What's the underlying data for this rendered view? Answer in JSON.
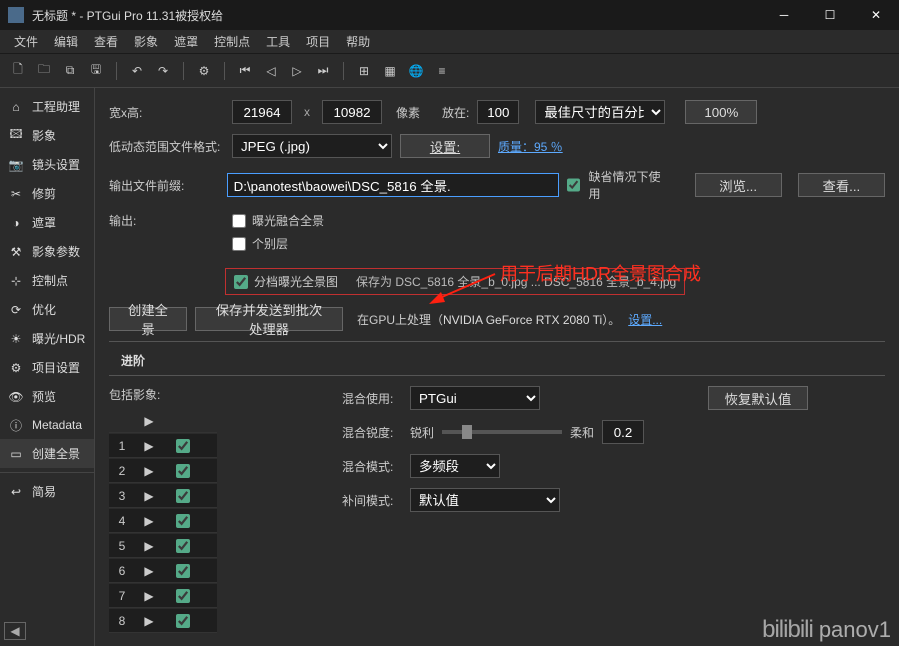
{
  "title": "无标题 * - PTGui Pro 11.31被授权给",
  "menu": [
    "文件",
    "编辑",
    "查看",
    "影象",
    "遮罩",
    "控制点",
    "工具",
    "项目",
    "帮助"
  ],
  "sidebar": [
    {
      "icon": "home",
      "label": "工程助理"
    },
    {
      "icon": "image",
      "label": "影象"
    },
    {
      "icon": "camera",
      "label": "镜头设置"
    },
    {
      "icon": "crop",
      "label": "修剪"
    },
    {
      "icon": "mask",
      "label": "遮罩"
    },
    {
      "icon": "params",
      "label": "影象参数"
    },
    {
      "icon": "ctrl",
      "label": "控制点"
    },
    {
      "icon": "opt",
      "label": "优化"
    },
    {
      "icon": "sun",
      "label": "曝光/HDR"
    },
    {
      "icon": "gear",
      "label": "项目设置"
    },
    {
      "icon": "eye",
      "label": "预览"
    },
    {
      "icon": "info",
      "label": "Metadata"
    },
    {
      "icon": "pano",
      "label": "创建全景"
    }
  ],
  "sidebar_simple": {
    "icon": "back",
    "label": "简易"
  },
  "dims": {
    "label": "宽x高:",
    "w": "21964",
    "h": "10982",
    "px": "像素",
    "store": "放在:",
    "pct": "100",
    "optsize": "最佳尺寸的百分比",
    "btn100": "100%"
  },
  "ldr": {
    "label": "低动态范围文件格式:",
    "fmt": "JPEG (.jpg)",
    "set": "设置:",
    "quality": "质量：95 ％"
  },
  "outfile": {
    "label": "输出文件前缀:",
    "path": "D:\\panotest\\baowei\\DSC_5816 全景.",
    "default_chk": true,
    "default_lbl": "缺省情况下使用",
    "browse": "浏览...",
    "view": "查看..."
  },
  "output": {
    "label": "输出:",
    "opt1": "曝光融合全景",
    "opt2": "个别层",
    "opt3": "分档曝光全景图",
    "opt3_save": "保存为 DSC_5816 全景_b_0.jpg ... DSC_5816 全景_b_4.jpg"
  },
  "annotation": "用于后期HDR全景图合成",
  "create": {
    "btn": "创建全景",
    "batch": "保存并发送到批次处理器",
    "gpu_prefix": "在GPU上处理（",
    "gpu_name": "NVIDIA GeForce RTX 2080 Ti",
    "gpu_suffix": "）。",
    "settings": "设置..."
  },
  "adv": {
    "title": "进阶",
    "include": "包括影象:",
    "blend_use": "混合使用:",
    "blend_val": "PTGui",
    "restore": "恢复默认值",
    "sharp": "混合锐度:",
    "sharp_l": "锐利",
    "sharp_r": "柔和",
    "sharp_val": "0.2",
    "mode": "混合模式:",
    "mode_val": "多频段",
    "interp": "补间模式:",
    "interp_val": "默认值"
  },
  "imgs": [
    1,
    2,
    3,
    4,
    5,
    6,
    7,
    8
  ],
  "watermark": "panov1"
}
